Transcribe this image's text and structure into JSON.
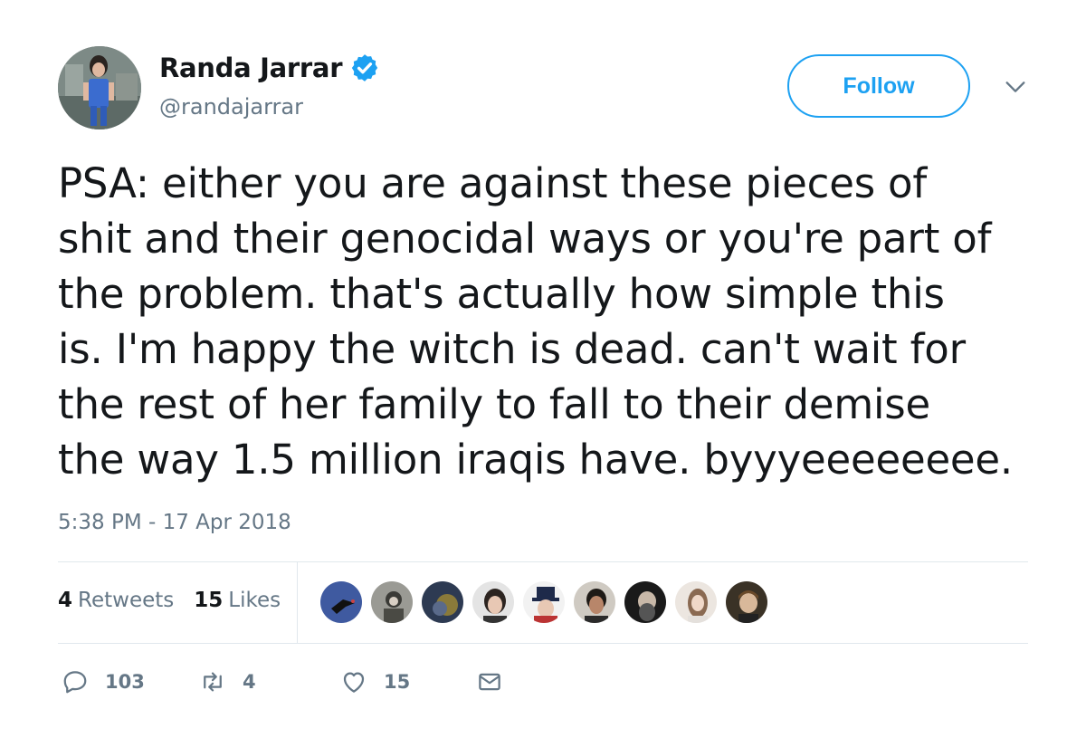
{
  "author": {
    "display_name": "Randa Jarrar",
    "handle": "@randajarrar",
    "verified_icon": "verified-badge-icon"
  },
  "follow_label": "Follow",
  "tweet": {
    "text": "PSA: either you are against these pieces of\nshit and their genocidal ways or you're part of\nthe problem. that's actually how simple this\nis. I'm happy the witch is dead. can't wait for\nthe rest of her family to fall to their demise\nthe way 1.5 million iraqis have. byyyeeeeeeee.",
    "timestamp": "5:38 PM - 17 Apr 2018"
  },
  "stats": {
    "retweets_count": "4",
    "retweets_label": "Retweets",
    "likes_count": "15",
    "likes_label": "Likes"
  },
  "actions": {
    "reply_count": "103",
    "retweet_count": "4",
    "like_count": "15"
  },
  "colors": {
    "accent": "#1da1f2",
    "text": "#14171a",
    "muted": "#657786",
    "border": "#e1e8ed"
  }
}
